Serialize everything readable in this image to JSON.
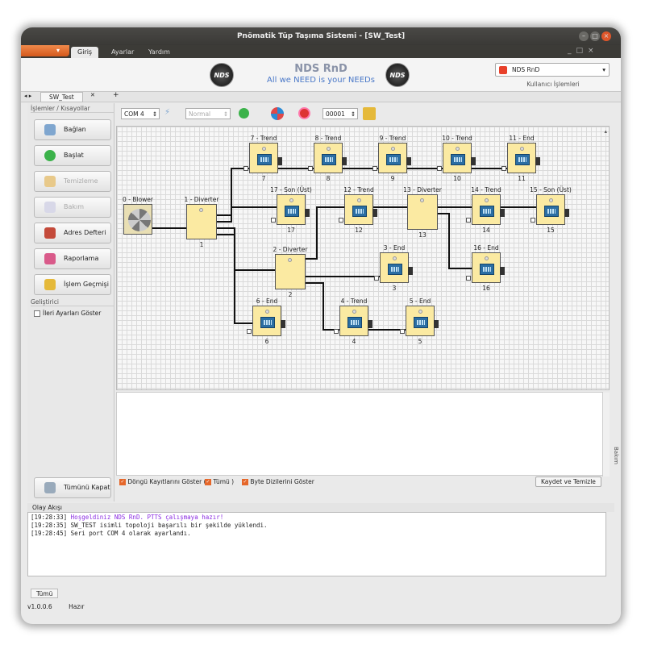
{
  "window": {
    "title": "Pnömatik Tüp Taşıma Sistemi - [SW_Test]"
  },
  "menu": {
    "tabs": [
      "Giriş",
      "Ayarlar",
      "Yardım"
    ]
  },
  "ribbon": {
    "logo_text": "NDS",
    "brand_title": "NDS RnD",
    "brand_slogan": "All we NEED is your NEEDs",
    "user_value": "NDS RnD",
    "user_label": "Kullanıcı İşlemleri"
  },
  "doc_tab": {
    "label": "SW_Test"
  },
  "left_panel": {
    "header": "İşlemler / Kısayollar",
    "buttons": [
      {
        "label": "Bağlan",
        "enabled": true
      },
      {
        "label": "Başlat",
        "enabled": true
      },
      {
        "label": "Temizleme",
        "enabled": false
      },
      {
        "label": "Bakım",
        "enabled": false
      },
      {
        "label": "Adres Defteri",
        "enabled": true
      },
      {
        "label": "Raporlama",
        "enabled": true
      },
      {
        "label": "İşlem Geçmişi",
        "enabled": true
      }
    ],
    "dev_header": "Geliştirici",
    "dev_checkbox": "İleri Ayarları Göster",
    "close_all": "Tümünü Kapat"
  },
  "toolbar": {
    "com_port": "COM 4",
    "mode": "Normal",
    "address": "00001"
  },
  "diagram": {
    "nodes": [
      {
        "id": "0",
        "label": "0 - Blower",
        "num": "",
        "type": "blower"
      },
      {
        "id": "1",
        "label": "1 - Diverter",
        "num": "1",
        "type": "diverter"
      },
      {
        "id": "2",
        "label": "2 - Diverter",
        "num": "2",
        "type": "diverter"
      },
      {
        "id": "3",
        "label": "3 - End",
        "num": "3",
        "type": "station"
      },
      {
        "id": "4",
        "label": "4 - Trend",
        "num": "4",
        "type": "station"
      },
      {
        "id": "5",
        "label": "5 - End",
        "num": "5",
        "type": "station"
      },
      {
        "id": "6",
        "label": "6 - End",
        "num": "6",
        "type": "station"
      },
      {
        "id": "7",
        "label": "7 - Trend",
        "num": "7",
        "type": "station"
      },
      {
        "id": "8",
        "label": "8 - Trend",
        "num": "8",
        "type": "station"
      },
      {
        "id": "9",
        "label": "9 - Trend",
        "num": "9",
        "type": "station"
      },
      {
        "id": "10",
        "label": "10 - Trend",
        "num": "10",
        "type": "station"
      },
      {
        "id": "11",
        "label": "11 - End",
        "num": "11",
        "type": "station"
      },
      {
        "id": "12",
        "label": "12 - Trend",
        "num": "12",
        "type": "station"
      },
      {
        "id": "13",
        "label": "13 - Diverter",
        "num": "13",
        "type": "diverter"
      },
      {
        "id": "14",
        "label": "14 - Trend",
        "num": "14",
        "type": "station"
      },
      {
        "id": "15",
        "label": "15 - Son (Üst)",
        "num": "15",
        "type": "station"
      },
      {
        "id": "16",
        "label": "16 - End",
        "num": "16",
        "type": "station"
      },
      {
        "id": "17",
        "label": "17 - Son (Üst)",
        "num": "17",
        "type": "station"
      }
    ]
  },
  "options": {
    "cycle_log": "Döngü Kayıtlarını Göster (",
    "all": "Tümü )",
    "byte_arrays": "Byte Dizilerini Göster",
    "save_clear": "Kaydet ve Temizle",
    "side_tab": "Bakım"
  },
  "events": {
    "header": "Olay Akışı",
    "lines": [
      {
        "time": "[19:28:33]",
        "text": "Hoşgeldiniz NDS RnD. PTTS çalışmaya hazır!"
      },
      {
        "time": "[19:28:35]",
        "text": "SW_TEST isimli topoloji başarılı bir şekilde yüklendi."
      },
      {
        "time": "[19:28:45]",
        "text": "Seri port COM 4 olarak ayarlandı."
      }
    ],
    "tab": "Tümü"
  },
  "status": {
    "version": "v1.0.0.6",
    "state": "Hazır"
  },
  "colors": {
    "accent": "#e5672a",
    "node_fill": "#fbeaa2",
    "phone": "#2b6ea3",
    "welcome": "#8a2be2"
  }
}
